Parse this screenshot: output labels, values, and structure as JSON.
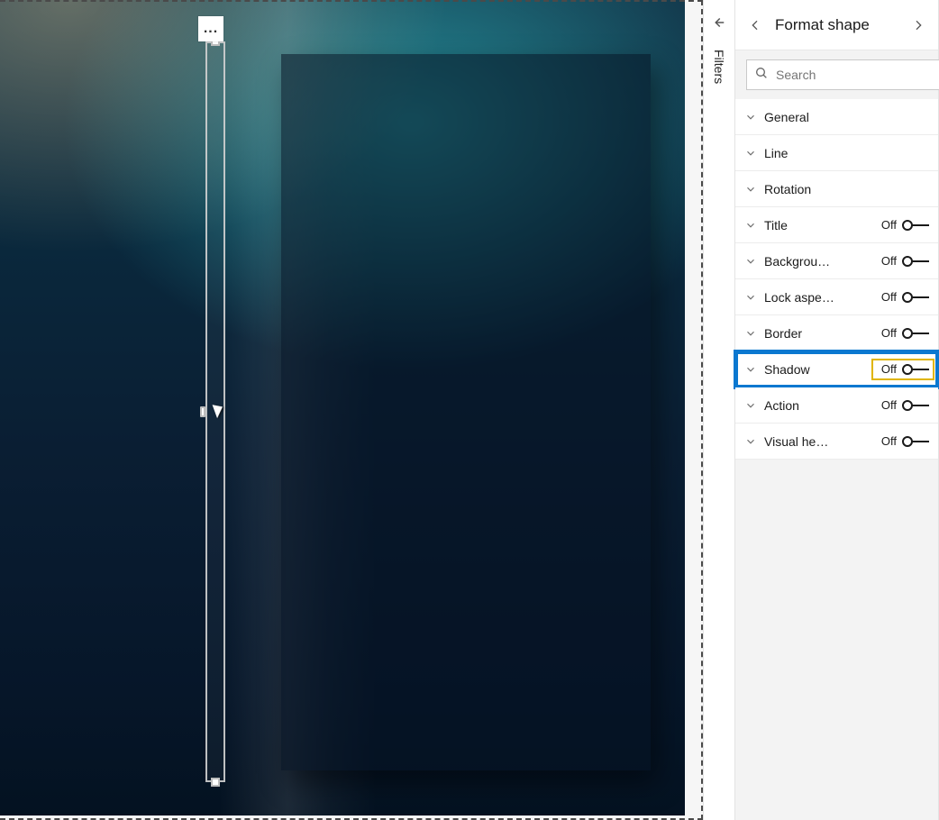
{
  "pane": {
    "title": "Format shape",
    "search_placeholder": "Search"
  },
  "filters": {
    "label": "Filters"
  },
  "controls": {
    "ellipsis": "..."
  },
  "toggle_states": {
    "off": "Off"
  },
  "properties": [
    {
      "label": "General",
      "has_toggle": false
    },
    {
      "label": "Line",
      "has_toggle": false
    },
    {
      "label": "Rotation",
      "has_toggle": false
    },
    {
      "label": "Title",
      "has_toggle": true,
      "state": "Off"
    },
    {
      "label": "Backgrou…",
      "has_toggle": true,
      "state": "Off"
    },
    {
      "label": "Lock aspe…",
      "has_toggle": true,
      "state": "Off"
    },
    {
      "label": "Border",
      "has_toggle": true,
      "state": "Off"
    },
    {
      "label": "Shadow",
      "has_toggle": true,
      "state": "Off",
      "highlighted": true
    },
    {
      "label": "Action",
      "has_toggle": true,
      "state": "Off"
    },
    {
      "label": "Visual he…",
      "has_toggle": true,
      "state": "Off"
    }
  ]
}
